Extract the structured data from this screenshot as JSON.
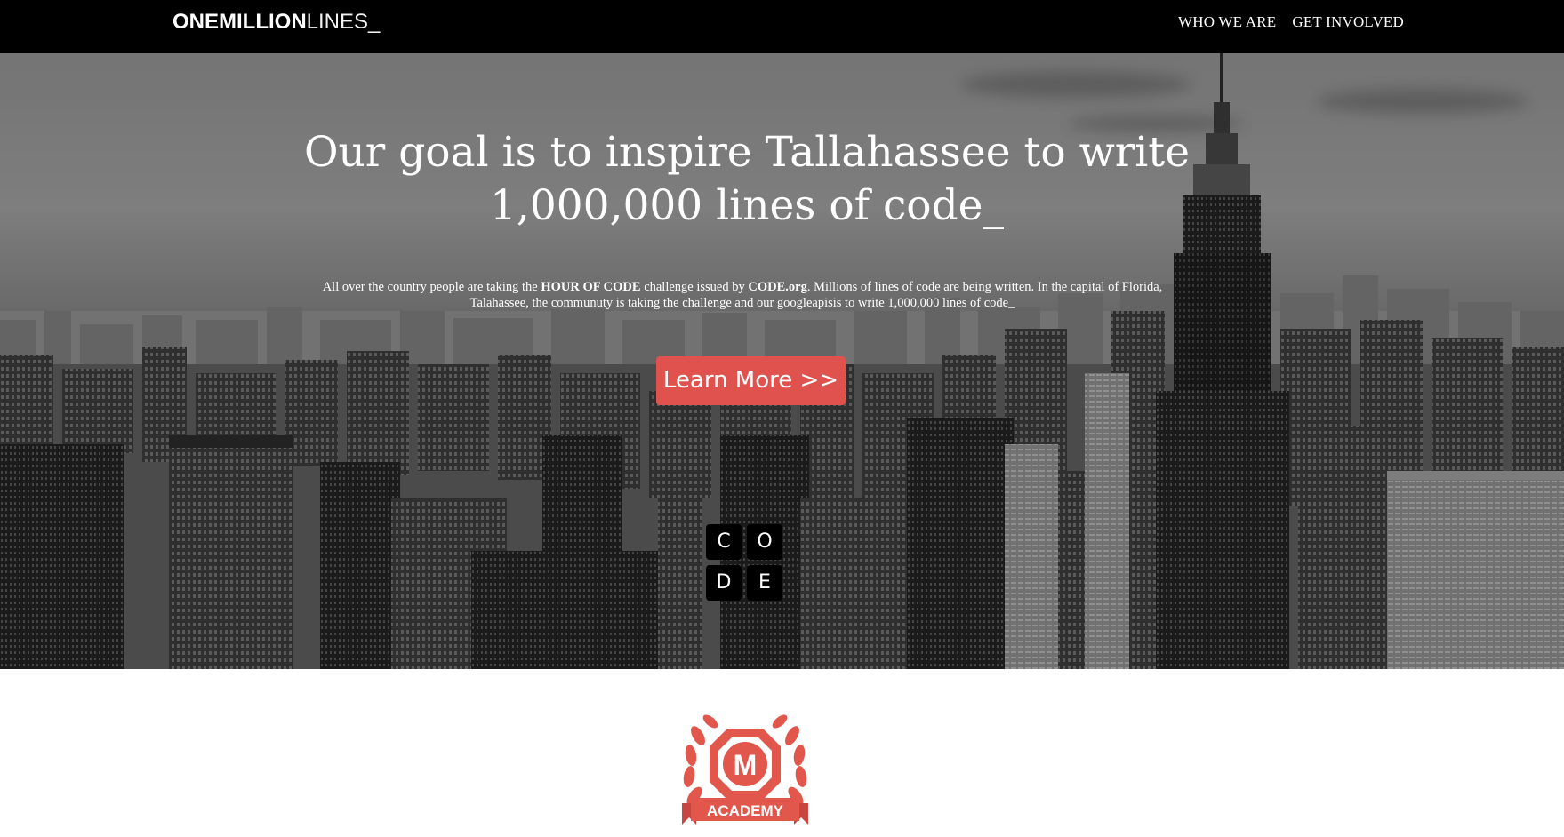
{
  "navbar": {
    "brand_bold": "ONEMILLION",
    "brand_light": "LINES_",
    "links": [
      "WHO WE ARE",
      "GET INVOLVED"
    ]
  },
  "hero": {
    "headline_line1": "Our goal is to inspire Tallahassee to write",
    "headline_line2": "1,000,000 lines of code_",
    "intro_part1": "All over the country people are taking the ",
    "intro_bold1": "HOUR OF CODE",
    "intro_part2": " challenge issued by ",
    "intro_bold2": "CODE.org",
    "intro_part3": ". Millions of lines of code are being written. In the capital of Florida, Talahassee, the communuty is taking the challenge and our googleapisis to write 1,000,000 lines of code_",
    "cta_label": "Learn More >>",
    "code_tiles": [
      "C",
      "O",
      "D",
      "E"
    ]
  },
  "academy": {
    "letter": "M",
    "label": "ACADEMY"
  },
  "colors": {
    "accent": "#e0524e",
    "navbar": "#000000",
    "badge": "#e2574c"
  },
  "icons": {
    "scroll_top": "arrow-up-icon"
  }
}
